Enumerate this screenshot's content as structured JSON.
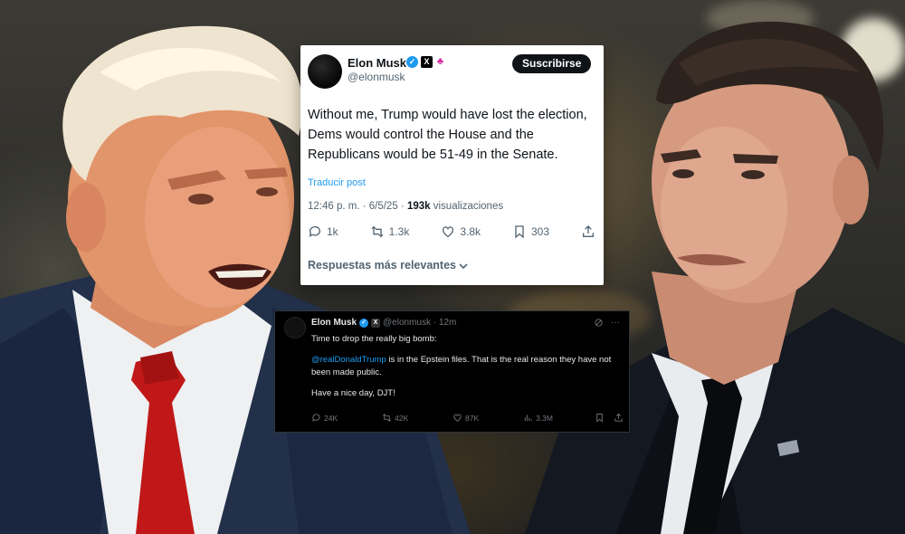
{
  "main_tweet": {
    "name": "Elon Musk",
    "handle": "@elonmusk",
    "follow_label": "Suscribirse",
    "text": "Without me, Trump would have lost the election, Dems would control the House and the Republicans would be 51-49 in the Senate.",
    "translate_label": "Traducir post",
    "timestamp": "12:46 p. m. · 6/5/25 · ",
    "views_count": "193k",
    "views_label": " visualizaciones",
    "replies": "1k",
    "reposts": "1.3k",
    "likes": "3.8k",
    "bookmarks": "303",
    "sort_label": "Respuestas más relevantes",
    "verified_color": "#1d9bf0"
  },
  "second_tweet": {
    "name": "Elon Musk",
    "handle": "@elonmusk · 12m",
    "line1": "Time to drop the really big bomb:",
    "mention": "@realDonaldTrump",
    "line2_rest": " is in the Epstein files. That is the real reason they have not been made public.",
    "line3": "Have a nice day, DJT!",
    "replies": "24K",
    "reposts": "42K",
    "likes": "87K",
    "views": "3.3M",
    "more_icon": "···"
  },
  "icons": {
    "verified": "verified-check-icon",
    "x_affiliation": "x-logo-icon",
    "gov_affiliation": "affiliation-icon"
  }
}
